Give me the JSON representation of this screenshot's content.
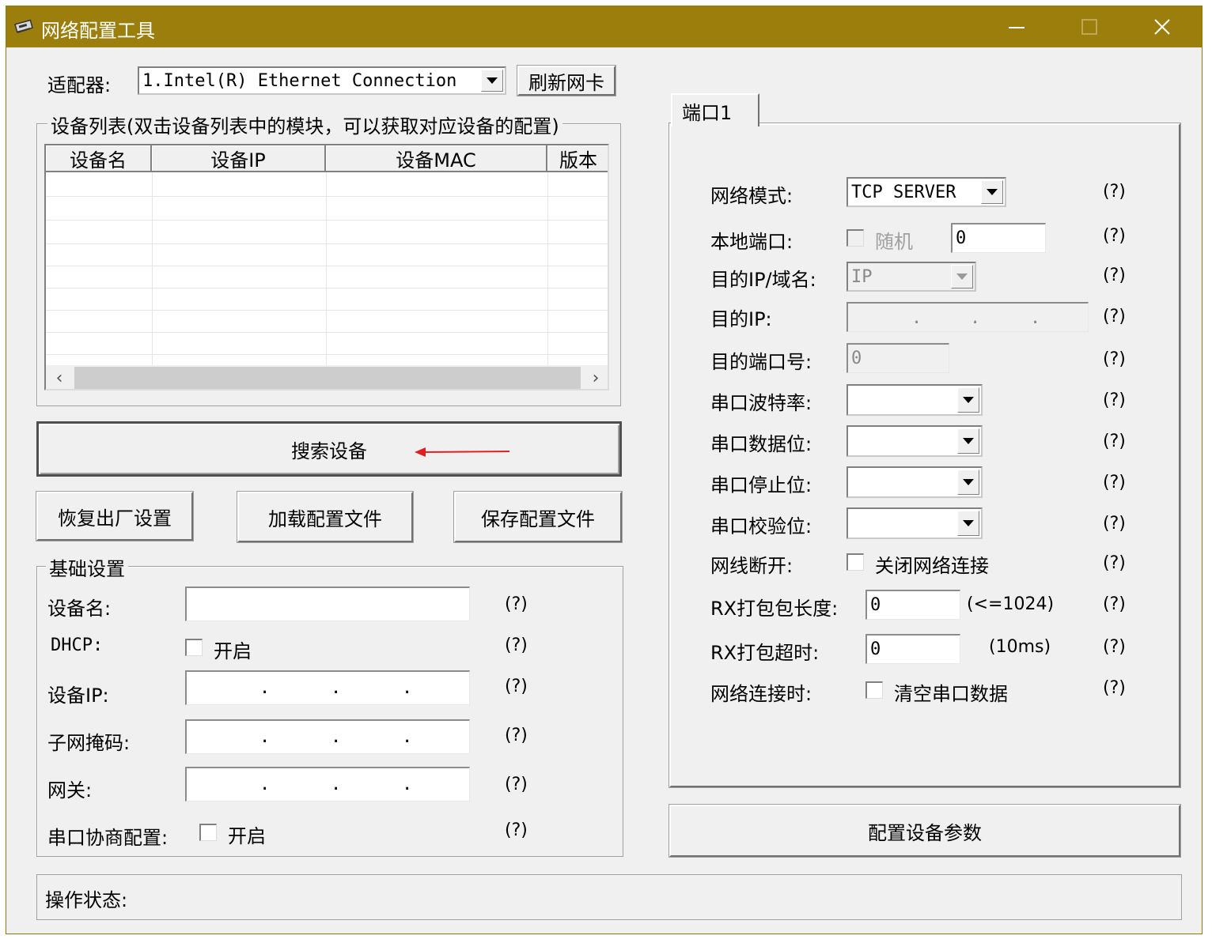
{
  "window": {
    "title": "网络配置工具",
    "min_icon": "minimize-icon",
    "max_icon": "maximize-icon",
    "close_icon": "close-icon",
    "title_color": "#9b7e0b"
  },
  "adapter": {
    "label": "适配器:",
    "selected": "1.Intel(R) Ethernet Connection",
    "refresh_label": "刷新网卡"
  },
  "device_list": {
    "caption": "设备列表(双击设备列表中的模块，可以获取对应设备的配置)",
    "columns": [
      "设备名",
      "设备IP",
      "设备MAC",
      "版本"
    ],
    "rows": []
  },
  "actions": {
    "search_label": "搜索设备",
    "factory_reset_label": "恢复出厂设置",
    "load_config_label": "加载配置文件",
    "save_config_label": "保存配置文件",
    "apply_label": "配置设备参数"
  },
  "basic": {
    "caption": "基础设置",
    "device_name_label": "设备名:",
    "device_name_value": "",
    "dhcp_label": "DHCP:",
    "dhcp_check_label": "开启",
    "dhcp_checked": false,
    "device_ip_label": "设备IP:",
    "subnet_label": "子网掩码:",
    "gateway_label": "网关:",
    "serial_negotiation_label": "串口协商配置:",
    "serial_negotiation_check_label": "开启",
    "serial_negotiation_checked": false,
    "help": "(?)"
  },
  "port": {
    "tab_label": "端口1",
    "net_mode_label": "网络模式:",
    "net_mode_value": "TCP SERVER",
    "local_port_label": "本地端口:",
    "random_label": "随机",
    "local_port_value": "0",
    "dest_ip_domain_label": "目的IP/域名:",
    "dest_ip_domain_value": "IP",
    "dest_ip_label": "目的IP:",
    "dest_port_label": "目的端口号:",
    "dest_port_value": "0",
    "baud_label": "串口波特率:",
    "baud_value": "",
    "databits_label": "串口数据位:",
    "databits_value": "",
    "stopbits_label": "串口停止位:",
    "stopbits_value": "",
    "parity_label": "串口校验位:",
    "parity_value": "",
    "cable_label": "网线断开:",
    "cable_check_label": "关闭网络连接",
    "rx_len_label": "RX打包包长度:",
    "rx_len_value": "0",
    "rx_len_note": "(<=1024)",
    "rx_timeout_label": "RX打包超时:",
    "rx_timeout_value": "0",
    "rx_timeout_note": "(10ms)",
    "on_connect_label": "网络连接时:",
    "on_connect_check_label": "清空串口数据",
    "help": "(?)"
  },
  "status": {
    "label": "操作状态:",
    "value": ""
  },
  "annotation": {
    "arrow_color": "#e02020"
  }
}
